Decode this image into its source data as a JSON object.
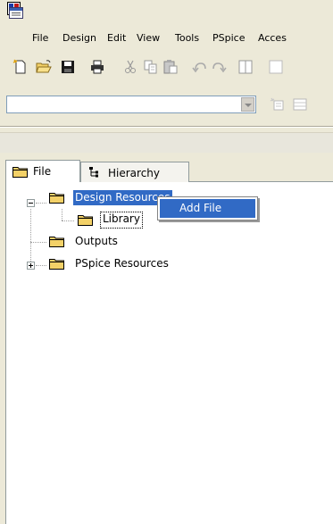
{
  "menu": {
    "items": [
      {
        "label": "File"
      },
      {
        "label": "Design"
      },
      {
        "label": "Edit"
      },
      {
        "label": "View"
      },
      {
        "label": "Tools"
      },
      {
        "label": "PSpice"
      },
      {
        "label": "Acces"
      }
    ]
  },
  "toolbar": {
    "icons": [
      "new-document-icon",
      "open-folder-icon",
      "save-icon",
      "print-icon",
      "cut-icon",
      "copy-icon",
      "paste-icon",
      "undo-icon",
      "redo-icon",
      "split-window-icon"
    ]
  },
  "tabs": {
    "file": "File",
    "hierarchy": "Hierarchy"
  },
  "tree": {
    "design_resources": "Design Resources",
    "library": "Library",
    "outputs": "Outputs",
    "pspice_resources": "PSpice Resources"
  },
  "context_menu": {
    "add_file": "Add File"
  },
  "colors": {
    "selection": "#316ac5",
    "folder": "#f3d168"
  }
}
